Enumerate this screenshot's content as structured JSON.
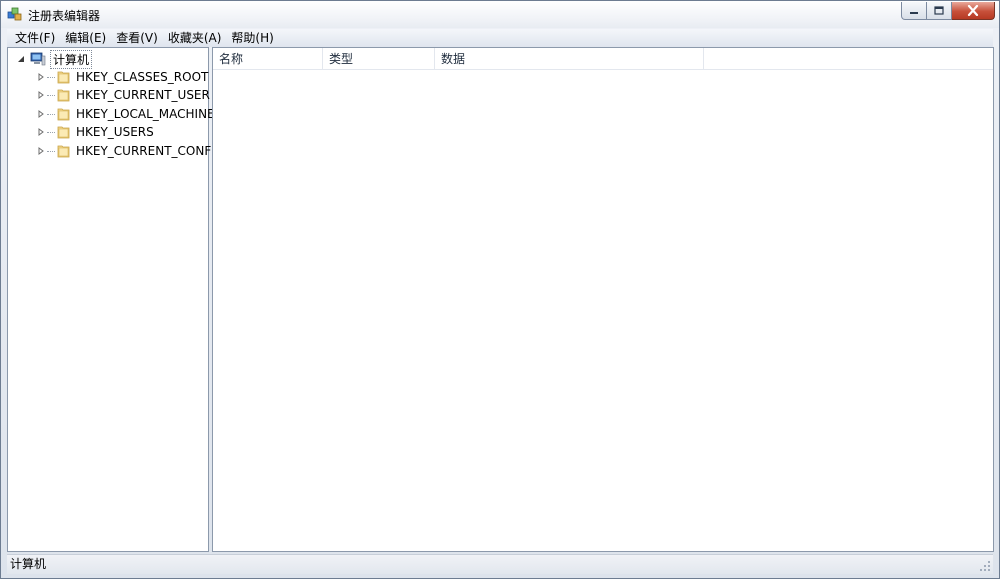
{
  "window": {
    "title": "注册表编辑器"
  },
  "menu": [
    {
      "label": "文件(F)"
    },
    {
      "label": "编辑(E)"
    },
    {
      "label": "查看(V)"
    },
    {
      "label": "收藏夹(A)"
    },
    {
      "label": "帮助(H)"
    }
  ],
  "tree": {
    "root": {
      "label": "计算机",
      "icon": "computer-icon",
      "expanded": true
    },
    "children": [
      {
        "label": "HKEY_CLASSES_ROOT",
        "icon": "folder-icon"
      },
      {
        "label": "HKEY_CURRENT_USER",
        "icon": "folder-icon"
      },
      {
        "label": "HKEY_LOCAL_MACHINE",
        "icon": "folder-icon"
      },
      {
        "label": "HKEY_USERS",
        "icon": "folder-icon"
      },
      {
        "label": "HKEY_CURRENT_CONFIG",
        "icon": "folder-icon"
      }
    ]
  },
  "list": {
    "columns": [
      {
        "label": "名称"
      },
      {
        "label": "类型"
      },
      {
        "label": "数据"
      }
    ]
  },
  "status": {
    "path": "计算机"
  },
  "colors": {
    "chrome": "#dde3ec",
    "border": "#8c99ab",
    "close_button": "#c7503a"
  }
}
